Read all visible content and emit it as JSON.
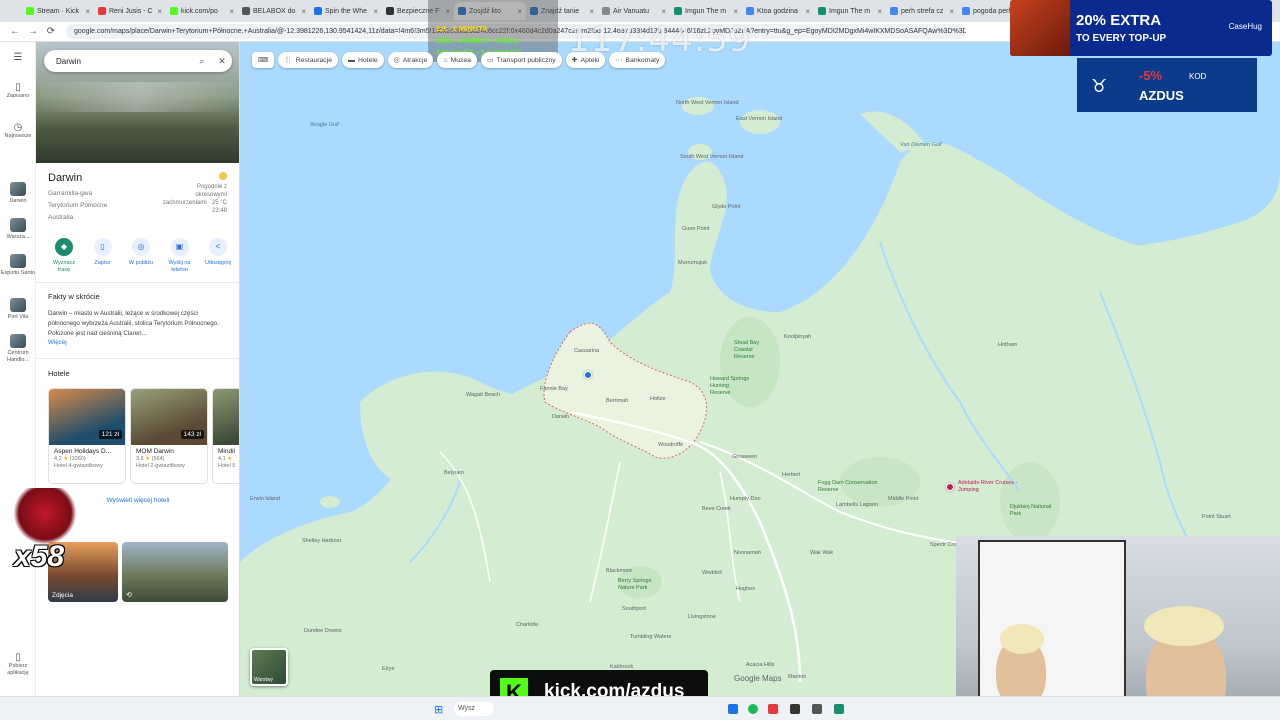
{
  "browser": {
    "tabs": [
      {
        "label": "Stream · Kick",
        "color": "#53fc18"
      },
      {
        "label": "Reni Jusis - C",
        "color": "#e53935"
      },
      {
        "label": "kick.com/po",
        "color": "#53fc18"
      },
      {
        "label": "BELABOX do",
        "color": "#555555"
      },
      {
        "label": "Spin the Whe",
        "color": "#1a73e8"
      },
      {
        "label": "Bezpieczne F",
        "color": "#333333"
      },
      {
        "label": "Zosjdź kto",
        "color": "#1565c0"
      },
      {
        "label": "Znajdź tanie",
        "color": "#1565c0"
      },
      {
        "label": "Air Vanuatu",
        "color": "#888888"
      },
      {
        "label": "Imgun The m",
        "color": "#1a8f6f"
      },
      {
        "label": "Ktoa godzina",
        "color": "#4285f4"
      },
      {
        "label": "Imgun The m",
        "color": "#1a8f6f"
      },
      {
        "label": "perh strefa cz",
        "color": "#4285f4"
      },
      {
        "label": "pogoda perh",
        "color": "#4285f4"
      }
    ],
    "url": "google.com/maps/place/Darwin+Terytorium+Północne,+Australia/@-12.3981226,130.9541424,11z/data=!4m6!3m5!1s0x2cc0a29a24c6cc22f:0x460d4c2d0a247c2!8m2!3d-12.4637333!4d130.8444446!16zL20vMDJ6ZnA?entry=ttu&g_ep=EgoyMDI2MDgxMi4wIKXMDSoASAFQAw%3D%3D"
  },
  "rail": {
    "items": [
      {
        "label": "Zapisano",
        "icon": "bookmark-icon"
      },
      {
        "label": "Najnowsze",
        "icon": "history-icon"
      },
      {
        "label": "Darwin"
      },
      {
        "label": "Warsza..."
      },
      {
        "label": "Espiritu Santo"
      },
      {
        "label": "Port Vila"
      },
      {
        "label": "Centrum Handlo..."
      },
      {
        "label": "Pobierz aplikację",
        "icon": "phone-icon"
      }
    ]
  },
  "panel": {
    "search_value": "Darwin",
    "title": "Darwin",
    "subtitle_lines": [
      "Garramilla-gwa",
      "Terytorium Północne",
      "Australia"
    ],
    "weather": {
      "line1": "Pogodnie z",
      "line2": "okresowymi",
      "line3": "zachmurzeniami · 25 °C",
      "time": "23:48"
    },
    "actions": [
      {
        "label": "Wyznacz trasę",
        "icon": "directions-icon",
        "primary": true
      },
      {
        "label": "Zapisz",
        "icon": "bookmark-icon"
      },
      {
        "label": "W pobliżu",
        "icon": "nearby-icon"
      },
      {
        "label": "Wyślij na telefon",
        "icon": "send-to-phone-icon"
      },
      {
        "label": "Udostępnij",
        "icon": "share-icon"
      }
    ],
    "facts_title": "Fakty w skrócie",
    "facts_text": "Darwin – miasto w Australii, leżące w środkowej części północnego wybrzeża Australii, stolica Terytorium Północnego. Położone jest nad cieśniną Claren...",
    "more_label": "Więcej",
    "hotels_title": "Hotele",
    "hotels": [
      {
        "name": "Aspen Holidays D...",
        "price": "121 zł",
        "rating": "4,2",
        "reviews": "(1060)",
        "kind": "Hotel 4-gwiazdkowy",
        "c1": "#b85a2e",
        "c2": "#1f4d6b"
      },
      {
        "name": "MOM Darwin",
        "price": "143 zł",
        "rating": "3,6",
        "reviews": "(564)",
        "kind": "Hotel 2-gwiazdkowy",
        "c1": "#6f7f55",
        "c2": "#a26a3d"
      },
      {
        "name": "Mindil",
        "price": "",
        "rating": "4,1",
        "reviews": "",
        "kind": "Hotel 5",
        "c1": "#7a8a6a",
        "c2": "#4a5a44"
      }
    ],
    "more_hotels_label": "Wyświetl więcej hoteli",
    "photos_label": "Zdjęcia"
  },
  "map": {
    "chips": [
      {
        "label": "Restauracje",
        "icon": "restaurant-icon"
      },
      {
        "label": "Hotele",
        "icon": "hotel-icon"
      },
      {
        "label": "Atrakcje",
        "icon": "attraction-icon"
      },
      {
        "label": "Muzea",
        "icon": "museum-icon"
      },
      {
        "label": "Transport publiczny",
        "icon": "transit-icon"
      },
      {
        "label": "Apteki",
        "icon": "pharmacy-icon"
      },
      {
        "label": "Bankomaty",
        "icon": "atm-icon"
      }
    ],
    "labels": {
      "northwest": "North West Vernon Island",
      "eastvernon": "East Vernon Island",
      "southwest": "South West Vernon Island",
      "gunn": "Gunn Point",
      "glyde": "Glyde Point",
      "murrumujuk": "Murrumujuk",
      "casuarina": "Casuarina",
      "fanniebay": "Fannie Bay",
      "wagait": "Wagait Beach",
      "berrimah": "Berrimah",
      "holtze": "Holtze",
      "shoal": "Shoal Bay Coastal Reserve",
      "howard": "Howard Springs Hunting Reserve",
      "koolpinyah": "Koolpinyah",
      "humpty": "Humpty Doo",
      "girraween": "Girraween",
      "herbert": "Herbert",
      "woodroffe": "Woodroffe",
      "darwin": "Darwin",
      "belyuen": "Belyuen",
      "fogdam": "Fogg Dam Conservation Reserve",
      "lambells": "Lambells Lagoon",
      "middlepoint": "Middle Point",
      "adelaide": "Adelaide River Cruises - Jumping",
      "djukbinj": "Djukbinj National Park",
      "pointstuart": "Point Stuart",
      "beatree": "Bees Creek",
      "noonamah": "Noonamah",
      "blackmore": "Blackmore",
      "berrysprings": "Berry Springs Nature Park",
      "southport": "Southport",
      "charlotte": "Charlotte",
      "tumbling": "Tumbling Waters",
      "livingstone": "Livingstone",
      "weddell": "Weddell",
      "hughes": "Hughes",
      "acacia": "Acacia Hills",
      "manton": "Manton",
      "dundee": "Dundee Downs",
      "shellyharbour": "Shelley Harbour",
      "wakwak": "Wak Wak",
      "hotham": "Hotham",
      "vandiemen": "Van Diemen Gulf",
      "beagle": "Beagle Gulf",
      "erwin": "Erwin Island",
      "elrye": "Elrye",
      "kakbrook": "Kakbrook",
      "spectrum": "Spectr Crocod"
    },
    "layers_label": "Warstwy",
    "attribution": "Google Maps"
  },
  "stream": {
    "timer": "117:44:59",
    "promo": [
      {
        "text": "2zł - 1 MINUTA",
        "color": "#ffd600"
      },
      {
        "text": "SUB - 8 MINUT + KOŁO",
        "color": "#53fc18"
      },
      {
        "text": "100 KICKS - 1.2 MINUTY",
        "color": "#53fc18"
      }
    ],
    "ad1_big": "20% EXTRA",
    "ad1_sub": "TO EVERY TOP-UP",
    "ad1_brand": "CaseHug",
    "ad2_pct": "-5%",
    "ad2_kod": "KOD",
    "ad2_code": "AZDUS",
    "kick_k": "K",
    "kick_text": "kick.com/azdus",
    "multiplier": "x58"
  },
  "taskbar": {
    "search_placeholder": "Wysz"
  }
}
